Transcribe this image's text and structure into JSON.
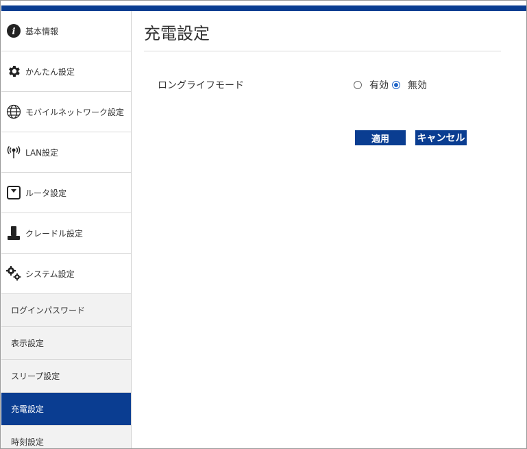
{
  "page_title": "充電設定",
  "sidebar": {
    "items": [
      {
        "label": "基本情報",
        "icon": "info-icon"
      },
      {
        "label": "かんたん設定",
        "icon": "gear-icon"
      },
      {
        "label": "モバイルネットワーク設定",
        "icon": "globe-icon"
      },
      {
        "label": "LAN設定",
        "icon": "antenna-icon"
      },
      {
        "label": "ルータ設定",
        "icon": "router-icon"
      },
      {
        "label": "クレードル設定",
        "icon": "cradle-icon"
      },
      {
        "label": "システム設定",
        "icon": "gears-icon"
      }
    ],
    "sub_items": [
      {
        "label": "ログインパスワード"
      },
      {
        "label": "表示設定"
      },
      {
        "label": "スリープ設定"
      },
      {
        "label": "充電設定",
        "active": true
      },
      {
        "label": "時刻設定"
      }
    ]
  },
  "settings": {
    "long_life_mode": {
      "label": "ロングライフモード",
      "options": [
        "有効",
        "無効"
      ],
      "selected": "無効"
    }
  },
  "buttons": {
    "apply": "適用",
    "cancel": "キャンセル"
  },
  "colors": {
    "brand": "#0a3d91",
    "radio_selected": "#1e64c8"
  }
}
